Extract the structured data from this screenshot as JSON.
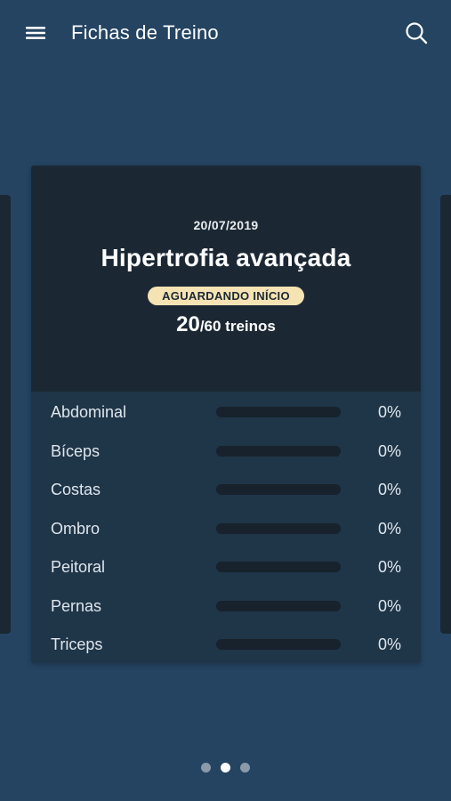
{
  "header": {
    "title": "Fichas de Treino"
  },
  "card": {
    "date": "20/07/2019",
    "title": "Hipertrofia avançada",
    "status": "AGUARDANDO INÍCIO",
    "completed": "20",
    "total_text": "/60 treinos"
  },
  "muscles": [
    {
      "name": "Abdominal",
      "percent_label": "0%",
      "progress": 0
    },
    {
      "name": "Bíceps",
      "percent_label": "0%",
      "progress": 0
    },
    {
      "name": "Costas",
      "percent_label": "0%",
      "progress": 0
    },
    {
      "name": "Ombro",
      "percent_label": "0%",
      "progress": 0
    },
    {
      "name": "Peitoral",
      "percent_label": "0%",
      "progress": 0
    },
    {
      "name": "Pernas",
      "percent_label": "0%",
      "progress": 0
    },
    {
      "name": "Triceps",
      "percent_label": "0%",
      "progress": 0
    }
  ],
  "pager": {
    "pages": 3,
    "active_index": 1
  },
  "colors": {
    "background": "#244462",
    "card_dark": "#1b2834",
    "card_list": "#1f3548",
    "badge": "#f5e3b3",
    "track": "#17222c"
  },
  "icons": {
    "menu": "hamburger-menu-icon",
    "search": "search-icon"
  }
}
